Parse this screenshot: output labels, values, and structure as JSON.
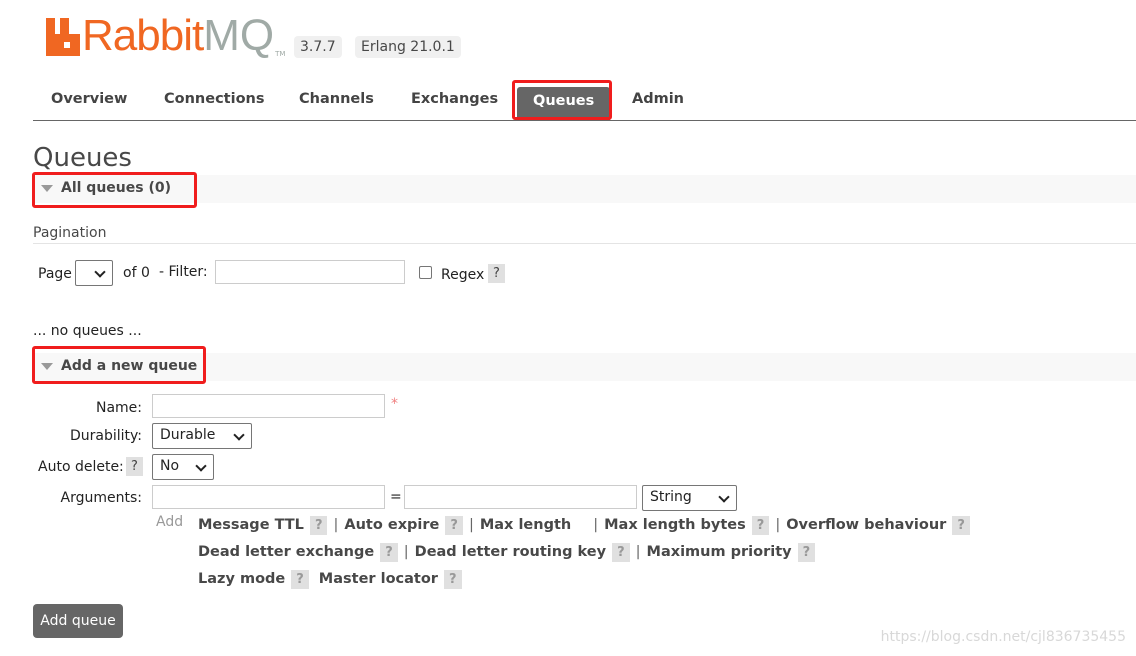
{
  "header": {
    "logo_text_a": "Rabbit",
    "logo_text_b": "MQ",
    "logo_tm": "TM",
    "version": "3.7.7",
    "erlang": "Erlang 21.0.1"
  },
  "nav": {
    "tabs": [
      {
        "label": "Overview"
      },
      {
        "label": "Connections"
      },
      {
        "label": "Channels"
      },
      {
        "label": "Exchanges"
      },
      {
        "label": "Queues",
        "active": true
      },
      {
        "label": "Admin"
      }
    ]
  },
  "page": {
    "title": "Queues"
  },
  "all_queues": {
    "title": "All queues (0)",
    "pagination_label": "Pagination",
    "page_label": "Page",
    "of_label": "of 0",
    "filter_label": "- Filter:",
    "filter_value": "",
    "regex_label": "Regex",
    "help": "?",
    "empty": "... no queues ..."
  },
  "add_queue": {
    "title": "Add a new queue",
    "name_label": "Name:",
    "name_value": "",
    "required": "*",
    "durability_label": "Durability:",
    "durability_value": "Durable",
    "auto_delete_label": "Auto delete:",
    "auto_delete_value": "No",
    "arguments_label": "Arguments:",
    "equals": "=",
    "arg_type": "String",
    "add_label": "Add",
    "args": [
      "Message TTL",
      "Auto expire",
      "Max length",
      "Max length bytes",
      "Overflow behaviour",
      "Dead letter exchange",
      "Dead letter routing key",
      "Maximum priority",
      "Lazy mode",
      "Master locator"
    ],
    "separator": "|",
    "help": "?",
    "submit": "Add queue"
  },
  "watermark": "https://blog.csdn.net/cjl836735455",
  "colors": {
    "brand_orange": "#f06722",
    "active_tab": "#666666",
    "highlight": "#f01d1d"
  }
}
